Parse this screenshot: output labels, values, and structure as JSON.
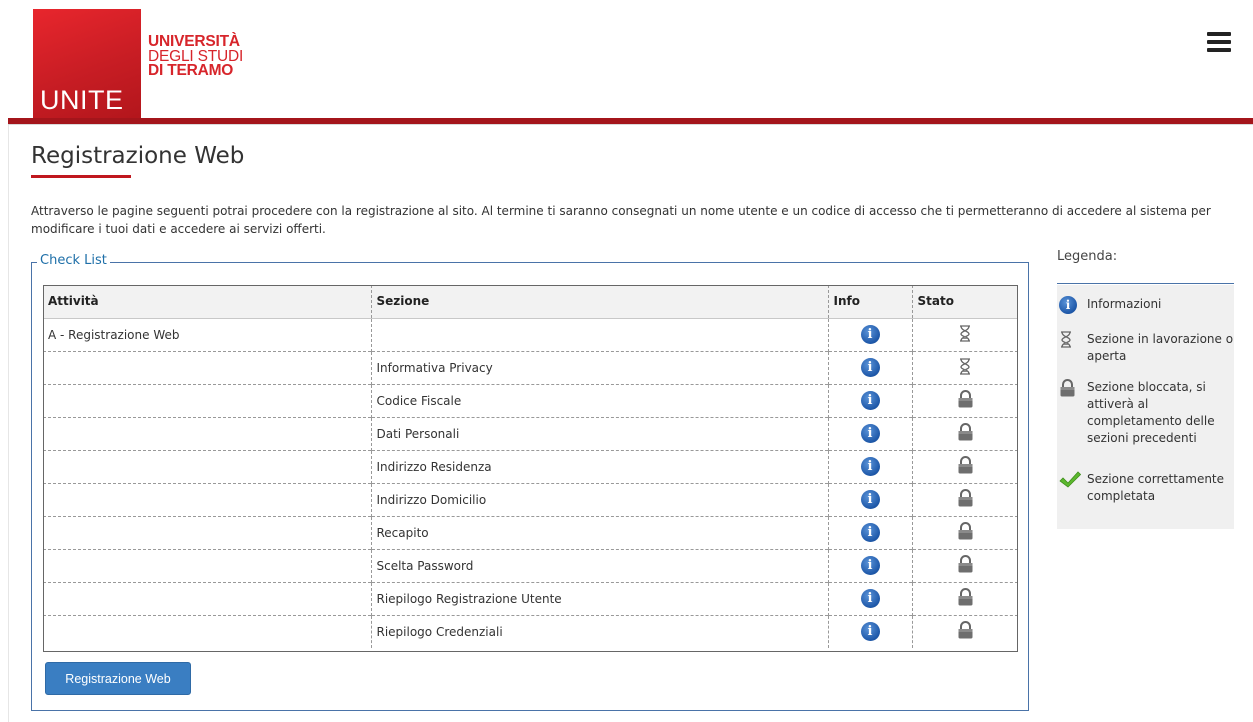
{
  "header": {
    "logo_main": "UNITE",
    "logo_line1": "UNIVERSITÀ",
    "logo_line2": "DEGLI STUDI",
    "logo_line3": "DI TERAMO",
    "menu_icon": "hamburger-icon"
  },
  "page": {
    "title": "Registrazione Web",
    "intro": "Attraverso le pagine seguenti potrai procedere con la registrazione al sito. Al termine ti saranno consegnati un nome utente e un codice di accesso che ti permetteranno di accedere al sistema per modificare i tuoi dati e accedere ai servizi offerti."
  },
  "checklist": {
    "legend": "Check List",
    "columns": [
      "Attività",
      "Sezione",
      "Info",
      "Stato"
    ],
    "rows": [
      {
        "attivita": "A - Registrazione Web",
        "sezione": "",
        "stato": "hourglass"
      },
      {
        "attivita": "",
        "sezione": "Informativa Privacy",
        "stato": "hourglass"
      },
      {
        "attivita": "",
        "sezione": "Codice Fiscale",
        "stato": "lock"
      },
      {
        "attivita": "",
        "sezione": "Dati Personali",
        "stato": "lock"
      },
      {
        "attivita": "",
        "sezione": "Indirizzo Residenza",
        "stato": "lock"
      },
      {
        "attivita": "",
        "sezione": "Indirizzo Domicilio",
        "stato": "lock"
      },
      {
        "attivita": "",
        "sezione": "Recapito",
        "stato": "lock"
      },
      {
        "attivita": "",
        "sezione": "Scelta Password",
        "stato": "lock"
      },
      {
        "attivita": "",
        "sezione": "Riepilogo Registrazione Utente",
        "stato": "lock"
      },
      {
        "attivita": "",
        "sezione": "Riepilogo Credenziali",
        "stato": "lock"
      }
    ],
    "button_label": "Registrazione Web"
  },
  "side_legend": {
    "title": "Legenda:",
    "items": [
      {
        "icon": "info-icon",
        "text": "Informazioni"
      },
      {
        "icon": "hourglass-icon",
        "text": "Sezione in lavorazione o aperta"
      },
      {
        "icon": "lock-icon",
        "text": "Sezione bloccata, si attiverà al completamento delle sezioni precedenti"
      },
      {
        "icon": "checkmark-icon",
        "text": "Sezione correttamente completata"
      }
    ]
  },
  "colors": {
    "brand_red": "#c81d24",
    "dark_red_bar": "#a4151b",
    "link_blue": "#1e6fa8",
    "button_blue": "#3a7ec2",
    "info_blue": "#1d57a8",
    "check_green": "#5cb82e"
  }
}
